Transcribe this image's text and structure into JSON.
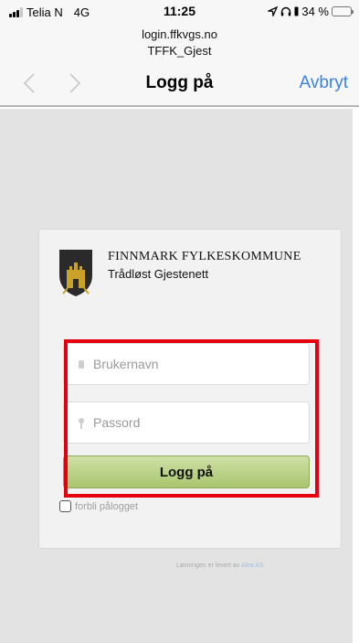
{
  "status_bar": {
    "carrier": "Telia N",
    "network": "4G",
    "time": "11:25",
    "battery_percent": "34 %",
    "battery_level": 0.34
  },
  "portal_header": {
    "url": "login.ffkvgs.no",
    "network_name": "TFFK_Gjest",
    "title": "Logg på",
    "cancel_label": "Avbryt",
    "back_icon": "chevron-left-icon",
    "forward_icon": "chevron-right-icon"
  },
  "login_card": {
    "organization": "FINNMARK FYLKESKOMMUNE",
    "subtitle": "Trådløst Gjestenett",
    "crest_icon": "coat-of-arms-icon",
    "username": {
      "placeholder": "Brukernavn",
      "value": ""
    },
    "password": {
      "placeholder": "Passord",
      "value": ""
    },
    "login_button": "Logg på",
    "remember_label": "forbli pålogget",
    "remember_checked": false
  },
  "footer": {
    "credit_text": "Løsningen er levert av",
    "credit_link": "Alea AS"
  },
  "colors": {
    "accent": "#3b82e3",
    "button_green": "#b8d384",
    "highlight": "#e5000f",
    "page_background": "#e3e3e3"
  }
}
